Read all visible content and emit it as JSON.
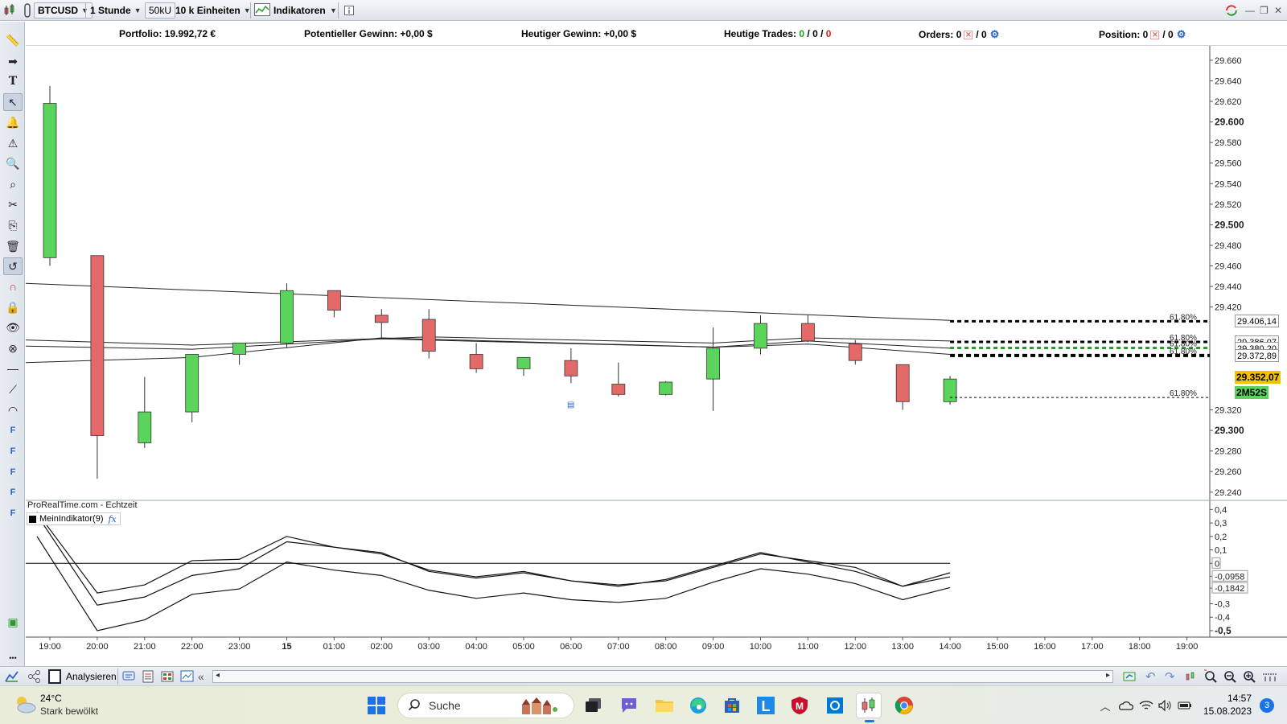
{
  "toolbar": {
    "symbol": "BTCUSD",
    "timeframe": "1 Stunde",
    "units_short": "50kU",
    "units": "10 k Einheiten",
    "indicators": "Indikatoren"
  },
  "infobar": {
    "portfolio_label": "Portfolio: 19.992,72 €",
    "potential_gain_label": "Potentieller Gewinn: +0,00 $",
    "todays_gain_label": "Heutiger Gewinn: +0,00 $",
    "todays_trades_label": "Heutige Trades:",
    "todays_trades_green": "0",
    "todays_trades_sep1": " / ",
    "todays_trades_black": "0",
    "todays_trades_sep2": " / ",
    "todays_trades_red": "0",
    "orders_label": "Orders:",
    "orders_value_a": "0",
    "orders_value_b": "/ 0",
    "position_label": "Position:",
    "position_value_a": "0",
    "position_value_b": "/ 0"
  },
  "left_tools": [
    "ruler-icon",
    "arrow-icon",
    "text-icon",
    "cursor-icon",
    "alert-bell-icon",
    "alert-icon",
    "zoom-icon",
    "zoom-area-icon",
    "tools-icon",
    "copy-icon",
    "trash-icon",
    "undo-draw-icon",
    "magnet-icon",
    "lock-icon",
    "eye-icon",
    "delete-objects-icon",
    "horizontal-line-icon",
    "trendline-icon",
    "arc-icon",
    "fib-f-icon",
    "fib-f-icon",
    "fib-f-icon",
    "fib-f-icon",
    "fib-f-icon"
  ],
  "chart": {
    "watermark": "ProRealTime.com - Echtzeit",
    "indicator_title": "MeinIndikator(9)",
    "indicator_fx": "fx"
  },
  "chart_data": [
    {
      "type": "candlestick",
      "title": "BTCUSD",
      "x": [
        "19:00",
        "20:00",
        "21:00",
        "22:00",
        "23:00",
        "15",
        "01:00",
        "02:00",
        "03:00",
        "04:00",
        "05:00",
        "06:00",
        "07:00",
        "08:00",
        "09:00",
        "10:00",
        "11:00",
        "12:00",
        "13:00",
        "14:00",
        "15:00",
        "16:00",
        "17:00",
        "18:00",
        "19:00"
      ],
      "candles": [
        {
          "t": "19:00",
          "o": 29468,
          "h": 29635,
          "l": 29460,
          "c": 29618
        },
        {
          "t": "20:00",
          "o": 29470,
          "h": 29470,
          "l": 29253,
          "c": 29295
        },
        {
          "t": "21:00",
          "o": 29288,
          "h": 29352,
          "l": 29283,
          "c": 29318
        },
        {
          "t": "22:00",
          "o": 29318,
          "h": 29374,
          "l": 29308,
          "c": 29374
        },
        {
          "t": "23:00",
          "o": 29374,
          "h": 29385,
          "l": 29364,
          "c": 29385
        },
        {
          "t": "15",
          "o": 29385,
          "h": 29443,
          "l": 29380,
          "c": 29436
        },
        {
          "t": "01:00",
          "o": 29436,
          "h": 29436,
          "l": 29410,
          "c": 29417
        },
        {
          "t": "02:00",
          "o": 29412,
          "h": 29418,
          "l": 29390,
          "c": 29405
        },
        {
          "t": "03:00",
          "o": 29408,
          "h": 29418,
          "l": 29370,
          "c": 29377
        },
        {
          "t": "04:00",
          "o": 29374,
          "h": 29385,
          "l": 29356,
          "c": 29360
        },
        {
          "t": "05:00",
          "o": 29360,
          "h": 29370,
          "l": 29353,
          "c": 29371
        },
        {
          "t": "06:00",
          "o": 29368,
          "h": 29380,
          "l": 29346,
          "c": 29353
        },
        {
          "t": "07:00",
          "o": 29345,
          "h": 29366,
          "l": 29333,
          "c": 29335
        },
        {
          "t": "08:00",
          "o": 29335,
          "h": 29348,
          "l": 29334,
          "c": 29347
        },
        {
          "t": "09:00",
          "o": 29350,
          "h": 29400,
          "l": 29319,
          "c": 29380
        },
        {
          "t": "10:00",
          "o": 29380,
          "h": 29412,
          "l": 29374,
          "c": 29404
        },
        {
          "t": "11:00",
          "o": 29404,
          "h": 29412,
          "l": 29386,
          "c": 29387
        },
        {
          "t": "12:00",
          "o": 29384,
          "h": 29388,
          "l": 29364,
          "c": 29368
        },
        {
          "t": "13:00",
          "o": 29364,
          "h": 29364,
          "l": 29320,
          "c": 29328
        },
        {
          "t": "14:00",
          "o": 29328,
          "h": 29353,
          "l": 29325,
          "c": 29350
        }
      ],
      "ma_lines": [
        {
          "x": [
            "19:00",
            "14:00"
          ],
          "y": [
            29443,
            29407
          ]
        },
        {
          "x": [
            "19:00",
            "22:00",
            "03:00",
            "09:00",
            "11:00",
            "14:00"
          ],
          "y": [
            29388,
            29383,
            29391,
            29385,
            29390,
            29387
          ]
        },
        {
          "x": [
            "19:00",
            "22:00",
            "02:00",
            "09:00",
            "11:00",
            "14:00"
          ],
          "y": [
            29382,
            29379,
            29389,
            29381,
            29387,
            29380
          ]
        },
        {
          "x": [
            "19:00",
            "22:00",
            "02:00",
            "09:00",
            "11:00",
            "14:00"
          ],
          "y": [
            29366,
            29371,
            29390,
            29381,
            29384,
            29374
          ]
        }
      ],
      "levels": [
        {
          "label": "61.80%",
          "tag": "29.406,14",
          "y": 29406.14,
          "style": "dotted-bold"
        },
        {
          "label": "61.80%",
          "tag": "29.386,07",
          "y": 29386.07,
          "style": "dotted-bold"
        },
        {
          "label": "61.80%",
          "tag": "29.380,20",
          "y": 29380.2,
          "style": "dashed-green"
        },
        {
          "label": "61.80%",
          "tag": "29.372,89",
          "y": 29372.89,
          "style": "dotted-heavy"
        },
        {
          "label": "61.80%",
          "tag": "",
          "y": 29332,
          "style": "dotted-thin"
        }
      ],
      "current_price": "29.352,07",
      "countdown": "2M52S",
      "y_ticks": [
        {
          "v": 29660,
          "label": "29.660",
          "bold": false
        },
        {
          "v": 29640,
          "label": "29.640",
          "bold": false
        },
        {
          "v": 29620,
          "label": "29.620",
          "bold": false
        },
        {
          "v": 29600,
          "label": "29.600",
          "bold": true
        },
        {
          "v": 29580,
          "label": "29.580",
          "bold": false
        },
        {
          "v": 29560,
          "label": "29.560",
          "bold": false
        },
        {
          "v": 29540,
          "label": "29.540",
          "bold": false
        },
        {
          "v": 29520,
          "label": "29.520",
          "bold": false
        },
        {
          "v": 29500,
          "label": "29.500",
          "bold": true
        },
        {
          "v": 29480,
          "label": "29.480",
          "bold": false
        },
        {
          "v": 29460,
          "label": "29.460",
          "bold": false
        },
        {
          "v": 29440,
          "label": "29.440",
          "bold": false
        },
        {
          "v": 29420,
          "label": "29.420",
          "bold": false
        },
        {
          "v": 29320,
          "label": "29.320",
          "bold": false
        },
        {
          "v": 29300,
          "label": "29.300",
          "bold": true
        },
        {
          "v": 29280,
          "label": "29.280",
          "bold": false
        },
        {
          "v": 29260,
          "label": "29.260",
          "bold": false
        },
        {
          "v": 29240,
          "label": "29.240",
          "bold": false
        }
      ],
      "ylim": [
        29232,
        29674
      ]
    },
    {
      "type": "line",
      "title": "MeinIndikator(9)",
      "x": [
        "19:00",
        "20:00",
        "21:00",
        "22:00",
        "23:00",
        "15",
        "01:00",
        "02:00",
        "03:00",
        "04:00",
        "05:00",
        "06:00",
        "07:00",
        "08:00",
        "09:00",
        "10:00",
        "11:00",
        "12:00",
        "13:00",
        "14:00"
      ],
      "series": [
        {
          "values": [
            0.38,
            -0.22,
            -0.16,
            0.02,
            0.03,
            0.2,
            0.12,
            0.07,
            -0.05,
            -0.1,
            -0.06,
            -0.13,
            -0.16,
            -0.13,
            -0.03,
            0.07,
            0.02,
            -0.03,
            -0.17,
            -0.07
          ]
        },
        {
          "values": [
            0.36,
            -0.31,
            -0.25,
            -0.09,
            -0.04,
            0.16,
            0.12,
            0.08,
            -0.06,
            -0.11,
            -0.07,
            -0.13,
            -0.17,
            -0.12,
            -0.02,
            0.08,
            0.01,
            -0.06,
            -0.17,
            -0.1
          ]
        },
        {
          "values": [
            0.2,
            -0.5,
            -0.42,
            -0.23,
            -0.19,
            0.01,
            -0.05,
            -0.09,
            -0.2,
            -0.26,
            -0.22,
            -0.27,
            -0.29,
            -0.26,
            -0.14,
            -0.04,
            -0.08,
            -0.15,
            -0.27,
            -0.18
          ]
        }
      ],
      "zero_line": 0,
      "y_ticks": [
        {
          "v": 0.4,
          "label": "0,4"
        },
        {
          "v": 0.3,
          "label": "0,3"
        },
        {
          "v": 0.2,
          "label": "0,2"
        },
        {
          "v": 0.1,
          "label": "0,1"
        },
        {
          "v": 0,
          "label": "0"
        },
        {
          "v": -0.0958,
          "label": "-0,0958"
        },
        {
          "v": -0.1842,
          "label": "-0,1842"
        },
        {
          "v": -0.3,
          "label": "-0,3"
        },
        {
          "v": -0.4,
          "label": "-0,4"
        },
        {
          "v": -0.5,
          "label": "-0,5"
        }
      ],
      "ylim": [
        -0.53,
        0.42
      ]
    }
  ],
  "chartbar": {
    "analyze_label": "Analysieren",
    "nav_prev": "«"
  },
  "taskbar": {
    "weather_temp": "24°C",
    "weather_desc": "Stark bewölkt",
    "search_placeholder": "Suche",
    "time": "14:57",
    "date": "15.08.2023",
    "notification_count": "3"
  },
  "colors": {
    "bull": "#5ad45a",
    "bear": "#e46a6a",
    "price_tag": "#f2c200",
    "countdown_tag": "#5ad45a"
  }
}
